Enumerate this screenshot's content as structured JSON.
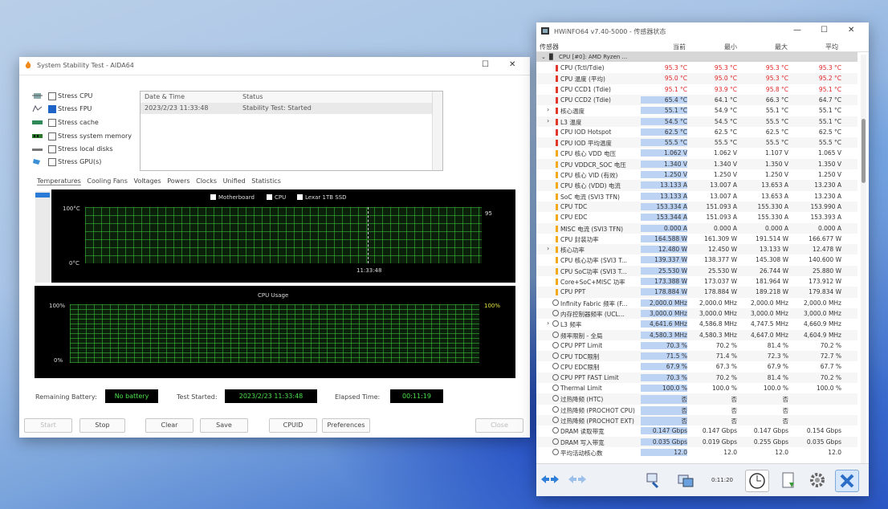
{
  "stability": {
    "title": "System Stability Test - AIDA64",
    "stress_items": [
      {
        "label": "Stress CPU",
        "checked": false
      },
      {
        "label": "Stress FPU",
        "checked": true
      },
      {
        "label": "Stress cache",
        "checked": false
      },
      {
        "label": "Stress system memory",
        "checked": false
      },
      {
        "label": "Stress local disks",
        "checked": false
      },
      {
        "label": "Stress GPU(s)",
        "checked": false
      }
    ],
    "log_headers": [
      "Date & Time",
      "Status"
    ],
    "log_rows": [
      {
        "time": "2023/2/23 11:33:48",
        "status": "Stability Test: Started"
      }
    ],
    "tabs": [
      "Temperatures",
      "Cooling Fans",
      "Voltages",
      "Powers",
      "Clocks",
      "Unified",
      "Statistics"
    ],
    "temp_chart": {
      "legend": [
        "Motherboard",
        "CPU",
        "Lexar 1TB SSD"
      ],
      "legend_checked": [
        false,
        true,
        false
      ],
      "y_top": "100°C",
      "y_bottom": "0°C",
      "right_label": "95",
      "marker": "11:33:48"
    },
    "usage_chart": {
      "title": "CPU Usage",
      "y_top": "100%",
      "y_bottom": "0%",
      "right_value": "100%"
    },
    "bottom": {
      "battery_label": "Remaining Battery:",
      "battery_value": "No battery",
      "started_label": "Test Started:",
      "started_value": "2023/2/23 11:33:48",
      "elapsed_label": "Elapsed Time:",
      "elapsed_value": "00:11:19"
    },
    "buttons": [
      "Start",
      "Stop",
      "Clear",
      "Save",
      "CPUID",
      "Preferences",
      "Close"
    ]
  },
  "sensors": {
    "title": "HWiNFO64 v7.40-5000 - 传感器状态",
    "columns": [
      "传感器",
      "当前",
      "最小",
      "最大",
      "平均"
    ],
    "group": "CPU [#0]: AMD Ryzen ...",
    "rows": [
      {
        "icon": "temp",
        "name": "CPU (Tctl/Tdie)",
        "cur": "95.3 °C",
        "min": "95.3 °C",
        "max": "95.3 °C",
        "avg": "95.3 °C",
        "red": true
      },
      {
        "icon": "temp",
        "name": "CPU 温度 (平均)",
        "cur": "95.0 °C",
        "min": "95.0 °C",
        "max": "95.3 °C",
        "avg": "95.2 °C",
        "red": true
      },
      {
        "icon": "temp",
        "name": "CPU CCD1 (Tdie)",
        "cur": "95.1 °C",
        "min": "93.9 °C",
        "max": "95.8 °C",
        "avg": "95.1 °C",
        "red": true
      },
      {
        "icon": "temp",
        "name": "CPU CCD2 (Tdie)",
        "cur": "65.4 °C",
        "min": "64.1 °C",
        "max": "66.3 °C",
        "avg": "64.7 °C"
      },
      {
        "icon": "temp",
        "expand": true,
        "name": "核心温度",
        "cur": "55.1 °C",
        "min": "54.9 °C",
        "max": "55.1 °C",
        "avg": "55.1 °C"
      },
      {
        "icon": "temp",
        "expand": true,
        "name": "L3 温度",
        "cur": "54.5 °C",
        "min": "54.5 °C",
        "max": "55.5 °C",
        "avg": "55.1 °C"
      },
      {
        "icon": "temp",
        "name": "CPU IOD Hotspot",
        "cur": "62.5 °C",
        "min": "62.5 °C",
        "max": "62.5 °C",
        "avg": "62.5 °C"
      },
      {
        "icon": "temp",
        "name": "CPU IOD 平均温度",
        "cur": "55.5 °C",
        "min": "55.5 °C",
        "max": "55.5 °C",
        "avg": "55.5 °C"
      },
      {
        "icon": "volt",
        "name": "CPU 核心 VDD 电压",
        "cur": "1.062 V",
        "min": "1.062 V",
        "max": "1.107 V",
        "avg": "1.065 V"
      },
      {
        "icon": "volt",
        "name": "CPU VDDCR_SOC 电压",
        "cur": "1.340 V",
        "min": "1.340 V",
        "max": "1.350 V",
        "avg": "1.350 V"
      },
      {
        "icon": "volt",
        "name": "CPU 核心 VID (有效)",
        "cur": "1.250 V",
        "min": "1.250 V",
        "max": "1.250 V",
        "avg": "1.250 V"
      },
      {
        "icon": "cur",
        "name": "CPU 核心 (VDD) 电流",
        "cur": "13.133 A",
        "min": "13.007 A",
        "max": "13.653 A",
        "avg": "13.230 A"
      },
      {
        "icon": "cur",
        "name": "SoC 电流 (SVI3 TFN)",
        "cur": "13.133 A",
        "min": "13.007 A",
        "max": "13.653 A",
        "avg": "13.230 A"
      },
      {
        "icon": "cur",
        "name": "CPU TDC",
        "cur": "153.334 A",
        "min": "151.093 A",
        "max": "155.330 A",
        "avg": "153.990 A"
      },
      {
        "icon": "cur",
        "name": "CPU EDC",
        "cur": "153.344 A",
        "min": "151.093 A",
        "max": "155.330 A",
        "avg": "153.393 A"
      },
      {
        "icon": "cur",
        "name": "MISC 电流 (SVI3 TFN)",
        "cur": "0.000 A",
        "min": "0.000 A",
        "max": "0.000 A",
        "avg": "0.000 A"
      },
      {
        "icon": "power",
        "name": "CPU 封装功率",
        "cur": "164.588 W",
        "min": "161.309 W",
        "max": "191.514 W",
        "avg": "166.677 W"
      },
      {
        "icon": "power",
        "expand": true,
        "name": "核心功率",
        "cur": "12.480 W",
        "min": "12.450 W",
        "max": "13.133 W",
        "avg": "12.478 W"
      },
      {
        "icon": "power",
        "name": "CPU 核心功率 (SVI3 T...",
        "cur": "139.337 W",
        "min": "138.377 W",
        "max": "145.308 W",
        "avg": "140.600 W"
      },
      {
        "icon": "power",
        "name": "CPU SoC功率 (SVI3 T...",
        "cur": "25.530 W",
        "min": "25.530 W",
        "max": "26.744 W",
        "avg": "25.880 W"
      },
      {
        "icon": "power",
        "name": "Core+SoC+MISC 功率",
        "cur": "173.388 W",
        "min": "173.037 W",
        "max": "181.964 W",
        "avg": "173.912 W"
      },
      {
        "icon": "power",
        "name": "CPU PPT",
        "cur": "178.884 W",
        "min": "178.884 W",
        "max": "189.218 W",
        "avg": "179.834 W"
      },
      {
        "icon": "clock",
        "name": "Infinity Fabric 频率 (F...",
        "cur": "2,000.0 MHz",
        "min": "2,000.0 MHz",
        "max": "2,000.0 MHz",
        "avg": "2,000.0 MHz"
      },
      {
        "icon": "clock",
        "name": "内存控制器频率 (UCL...",
        "cur": "3,000.0 MHz",
        "min": "3,000.0 MHz",
        "max": "3,000.0 MHz",
        "avg": "3,000.0 MHz"
      },
      {
        "icon": "clock",
        "expand": true,
        "name": "L3 频率",
        "cur": "4,641.6 MHz",
        "min": "4,586.8 MHz",
        "max": "4,747.5 MHz",
        "avg": "4,660.9 MHz"
      },
      {
        "icon": "clock",
        "name": "频率限制 - 全局",
        "cur": "4,580.3 MHz",
        "min": "4,580.3 MHz",
        "max": "4,647.0 MHz",
        "avg": "4,604.9 MHz"
      },
      {
        "icon": "clock",
        "name": "CPU PPT Limit",
        "cur": "70.3 %",
        "min": "70.2 %",
        "max": "81.4 %",
        "avg": "70.2 %"
      },
      {
        "icon": "clock",
        "name": "CPU TDC限制",
        "cur": "71.5 %",
        "min": "71.4 %",
        "max": "72.3 %",
        "avg": "72.7 %"
      },
      {
        "icon": "clock",
        "name": "CPU EDC限制",
        "cur": "67.9 %",
        "min": "67.3 %",
        "max": "67.9 %",
        "avg": "67.7 %"
      },
      {
        "icon": "clock",
        "name": "CPU PPT FAST Limit",
        "cur": "70.3 %",
        "min": "70.2 %",
        "max": "81.4 %",
        "avg": "70.2 %"
      },
      {
        "icon": "clock",
        "name": "Thermal Limit",
        "cur": "100.0 %",
        "min": "100.0 %",
        "max": "100.0 %",
        "avg": "100.0 %"
      },
      {
        "icon": "clock",
        "name": "过热降频 (HTC)",
        "cur": "否",
        "min": "否",
        "max": "否",
        "avg": ""
      },
      {
        "icon": "clock",
        "name": "过热降频 (PROCHOT CPU)",
        "cur": "否",
        "min": "否",
        "max": "否",
        "avg": ""
      },
      {
        "icon": "clock",
        "name": "过热降频 (PROCHOT EXT)",
        "cur": "否",
        "min": "否",
        "max": "否",
        "avg": ""
      },
      {
        "icon": "clock",
        "name": "DRAM 读取带宽",
        "cur": "0.147 Gbps",
        "min": "0.147 Gbps",
        "max": "0.147 Gbps",
        "avg": "0.154 Gbps"
      },
      {
        "icon": "clock",
        "name": "DRAM 写入带宽",
        "cur": "0.035 Gbps",
        "min": "0.019 Gbps",
        "max": "0.255 Gbps",
        "avg": "0.035 Gbps"
      },
      {
        "icon": "clock",
        "name": "平均活动核心数",
        "cur": "12.0",
        "min": "12.0",
        "max": "12.0",
        "avg": "12.0"
      }
    ],
    "timer": "0:11:20",
    "toolbar_icons": [
      "nav-arrows-icon",
      "nav-arrows-disabled-icon",
      "network-icon",
      "export-icon",
      "clock-icon",
      "report-icon",
      "settings-icon",
      "close-x-icon"
    ]
  },
  "colors": {
    "accent": "#1f63c6",
    "chart_grid": "#3cc83c",
    "value_green": "#4ce04c",
    "hot": "#e02424",
    "highlight": "#bcd3f3"
  }
}
